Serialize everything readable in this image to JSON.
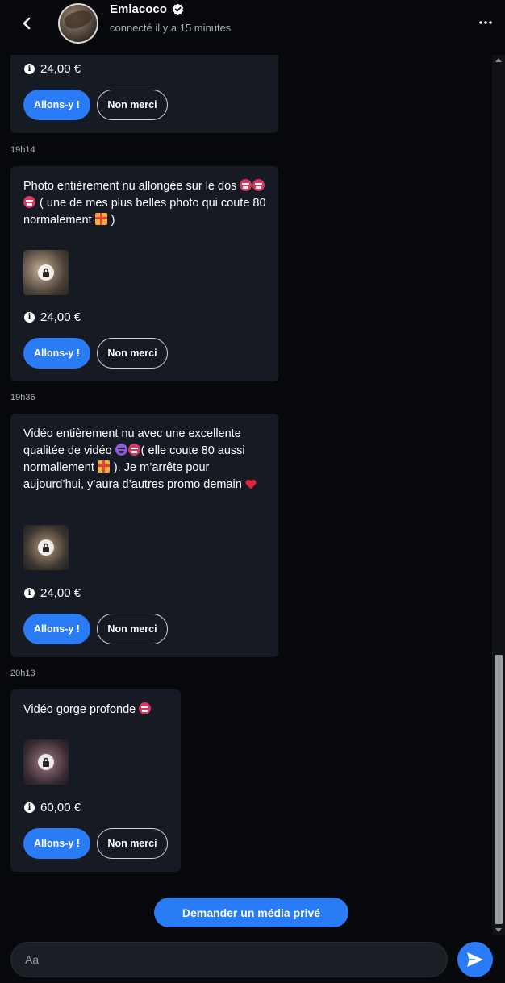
{
  "header": {
    "name": "Emlacoco",
    "status": "connecté il y a 15 minutes",
    "icons": {
      "back": "chevron-left-icon",
      "verified": "verified-badge-icon",
      "more": "more-horizontal-icon"
    }
  },
  "messages": [
    {
      "price": "24,00 €",
      "accept_label": "Allons-y !",
      "decline_label": "Non merci"
    },
    {
      "time": "19h14",
      "text_part1": "Photo entièrement nu allongée sur le dos ",
      "text_part2": "( une de mes plus belles photo qui coute 80 normalement ",
      "text_part3": " )",
      "price": "24,00 €",
      "accept_label": "Allons-y !",
      "decline_label": "Non merci"
    },
    {
      "time": "19h36",
      "text_part1": "Vidéo entièrement nu avec une excellente qualitée de vidéo ",
      "text_part2": "( elle coute 80 aussi normallement ",
      "text_part3": " ). Je m’arrête pour aujourd’hui, y’aura d’autres promo demain ",
      "price": "24,00 €",
      "accept_label": "Allons-y !",
      "decline_label": "Non merci"
    },
    {
      "time": "20h13",
      "text_part1": "Vidéo gorge profonde ",
      "price": "60,00 €",
      "accept_label": "Allons-y !",
      "decline_label": "Non merci"
    }
  ],
  "request_button_label": "Demander un média privé",
  "composer": {
    "placeholder": "Aa"
  },
  "colors": {
    "accent": "#2a7bf6",
    "bubble": "#161a22",
    "background": "#06080c"
  }
}
